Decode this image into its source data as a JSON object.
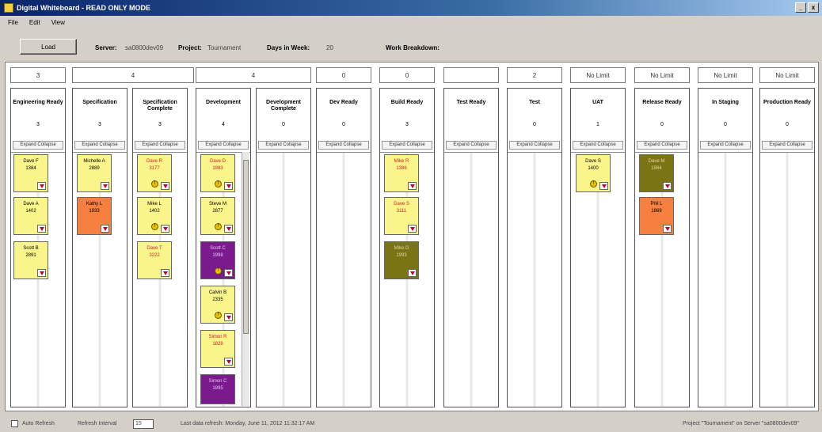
{
  "window": {
    "title": "Digital Whiteboard - READ ONLY MODE",
    "minimize": "_",
    "close": "x"
  },
  "menu": [
    "File",
    "Edit",
    "View"
  ],
  "toolbar": {
    "load_label": "Load",
    "server_label": "Server:",
    "server_value": "sa0800dev09",
    "project_label": "Project:",
    "project_value": "Tournament",
    "days_label": "Days in Week:",
    "days_value": "20",
    "wbs_label": "Work Breakdown:"
  },
  "groups": [
    "3",
    "4",
    "4",
    "0",
    "0",
    "",
    "2",
    "No Limit",
    "No Limit",
    "No Limit",
    "No Limit"
  ],
  "columns": [
    {
      "title": "Engineering Ready",
      "count": "3",
      "expand": "Expand Collapse"
    },
    {
      "title": "Specification",
      "count": "3",
      "expand": "Expand Collapse"
    },
    {
      "title": "Specification Complete",
      "count": "3",
      "expand": "Expand Collapse"
    },
    {
      "title": "Development",
      "count": "4",
      "expand": "Expand Collapse"
    },
    {
      "title": "Development Complete",
      "count": "0",
      "expand": "Expand Collapse"
    },
    {
      "title": "Dev Ready",
      "count": "0",
      "expand": "Expand Collapse"
    },
    {
      "title": "Build Ready",
      "count": "3",
      "expand": "Expand Collapse"
    },
    {
      "title": "Test Ready",
      "count": "",
      "expand": "Expand Collapse"
    },
    {
      "title": "Test",
      "count": "0",
      "expand": "Expand Collapse"
    },
    {
      "title": "UAT",
      "count": "1",
      "expand": "Expand Collapse"
    },
    {
      "title": "Release Ready",
      "count": "0",
      "expand": "Expand Collapse"
    },
    {
      "title": "In Staging",
      "count": "0",
      "expand": "Expand Collapse"
    },
    {
      "title": "Production Ready",
      "count": "0",
      "expand": "Expand Collapse"
    }
  ],
  "cards": [
    {
      "name": "Dave F",
      "num": "1384",
      "color": "yellow",
      "flag": false
    },
    {
      "name": "Dave A",
      "num": "1402",
      "color": "yellow",
      "flag": false
    },
    {
      "name": "Scott B",
      "num": "2891",
      "color": "yellow",
      "flag": false
    },
    {
      "name": "Michelle A",
      "num": "2889",
      "color": "yellow",
      "flag": false
    },
    {
      "name": "Kathy L",
      "num": "1933",
      "color": "orange",
      "flag": false
    },
    {
      "name": "Dave R",
      "num": "3177",
      "color": "yellow",
      "red": true,
      "flag": true
    },
    {
      "name": "Mike L",
      "num": "1402",
      "color": "yellow",
      "flag": true
    },
    {
      "name": "Dave T",
      "num": "3222",
      "color": "yellow",
      "red": true,
      "flag": false
    },
    {
      "name": "Dave D",
      "num": "1983",
      "color": "yellow",
      "red": true,
      "flag": true
    },
    {
      "name": "Steve M",
      "num": "2877",
      "color": "yellow",
      "flag": true
    },
    {
      "name": "Scott C",
      "num": "1998",
      "color": "purple",
      "flag": true
    },
    {
      "name": "Calvin B",
      "num": "2335",
      "color": "yellow",
      "flag": true
    },
    {
      "name": "Simon R",
      "num": "1828",
      "color": "yellow",
      "red": true,
      "flag": false
    },
    {
      "name": "Simon C",
      "num": "1995",
      "color": "purple",
      "flag": false
    },
    {
      "name": "Mike R",
      "num": "1386",
      "color": "yellow",
      "red": true,
      "flag": false
    },
    {
      "name": "Dave S",
      "num": "3111",
      "color": "yellow",
      "red": true,
      "flag": false
    },
    {
      "name": "Mike D",
      "num": "1993",
      "color": "olive",
      "flag": false
    },
    {
      "name": "Dave S",
      "num": "1400",
      "color": "yellow",
      "flag": true
    },
    {
      "name": "Dave M",
      "num": "1984",
      "color": "olive",
      "flag": false
    },
    {
      "name": "Phil L",
      "num": "1869",
      "color": "orange",
      "flag": false
    }
  ],
  "status": {
    "auto_refresh": "Auto Refresh",
    "interval_label": "Refresh Interval",
    "interval_value": "15",
    "last_refresh": "Last data refresh: Monday, June 11, 2012 11:32:17 AM",
    "right": "Project \"Tournament\" on Server \"sa0800dev09\""
  },
  "colors": {
    "card_yellow": "#faf58a",
    "card_orange": "#f58040",
    "card_purple": "#7a1a8c",
    "card_olive": "#7a7414"
  }
}
